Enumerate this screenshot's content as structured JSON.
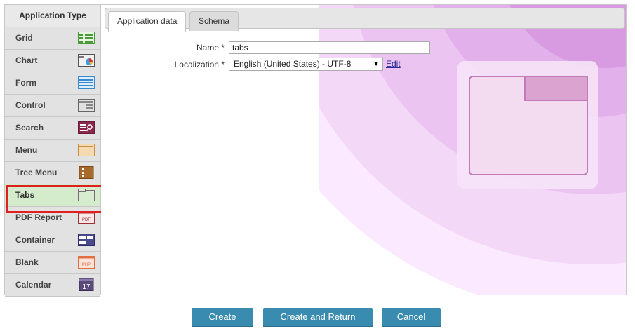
{
  "sidebar": {
    "header": "Application Type",
    "items": [
      {
        "label": "Grid",
        "icon": "grid-icon",
        "selected": false
      },
      {
        "label": "Chart",
        "icon": "chart-icon",
        "selected": false
      },
      {
        "label": "Form",
        "icon": "form-icon",
        "selected": false
      },
      {
        "label": "Control",
        "icon": "control-icon",
        "selected": false
      },
      {
        "label": "Search",
        "icon": "search-icon",
        "selected": false
      },
      {
        "label": "Menu",
        "icon": "menu-icon",
        "selected": false
      },
      {
        "label": "Tree Menu",
        "icon": "tree-menu-icon",
        "selected": false
      },
      {
        "label": "Tabs",
        "icon": "tabs-icon",
        "selected": true
      },
      {
        "label": "PDF Report",
        "icon": "pdf-report-icon",
        "selected": false
      },
      {
        "label": "Container",
        "icon": "container-icon",
        "selected": false
      },
      {
        "label": "Blank",
        "icon": "blank-icon",
        "selected": false
      },
      {
        "label": "Calendar",
        "icon": "calendar-icon",
        "selected": false
      }
    ],
    "icon_text": {
      "pdf": "PDF",
      "php": "PHP",
      "calendar_day": "17"
    }
  },
  "tabs": [
    {
      "label": "Application data",
      "active": true
    },
    {
      "label": "Schema",
      "active": false
    }
  ],
  "form": {
    "name_label": "Name *",
    "name_value": "tabs",
    "localization_label": "Localization *",
    "localization_value": "English (United States) - UTF-8",
    "edit_link": "Edit"
  },
  "buttons": {
    "create": "Create",
    "create_and_return": "Create and Return",
    "cancel": "Cancel"
  },
  "colors": {
    "selected_item_bg": "#d4ebcc",
    "highlight_border": "#e02020",
    "button_bg": "#3a8bb0",
    "background_accent": "#e8b8f0"
  }
}
